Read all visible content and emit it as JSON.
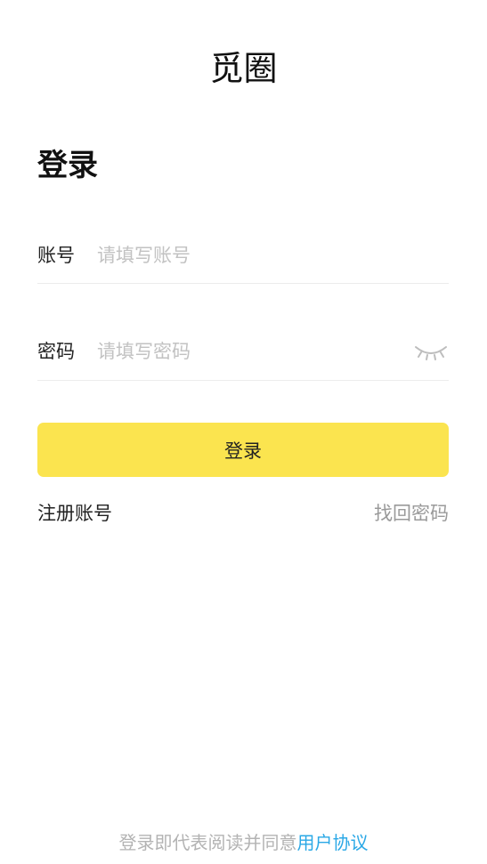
{
  "header": {
    "app_title": "觅圈"
  },
  "login_form": {
    "heading": "登录",
    "account": {
      "label": "账号",
      "value": "",
      "placeholder": "请填写账号"
    },
    "password": {
      "label": "密码",
      "value": "",
      "placeholder": "请填写密码",
      "visibility_icon": "eye-closed-icon"
    },
    "submit_label": "登录",
    "register_label": "注册账号",
    "forgot_password_label": "找回密码"
  },
  "footer": {
    "agreement_prefix": "登录即代表阅读并同意",
    "agreement_link": "用户协议"
  },
  "colors": {
    "accent": "#fbe44f",
    "link": "#2aa8e6",
    "secondary_text": "#9a9a9a",
    "placeholder": "#c2c2c2"
  }
}
